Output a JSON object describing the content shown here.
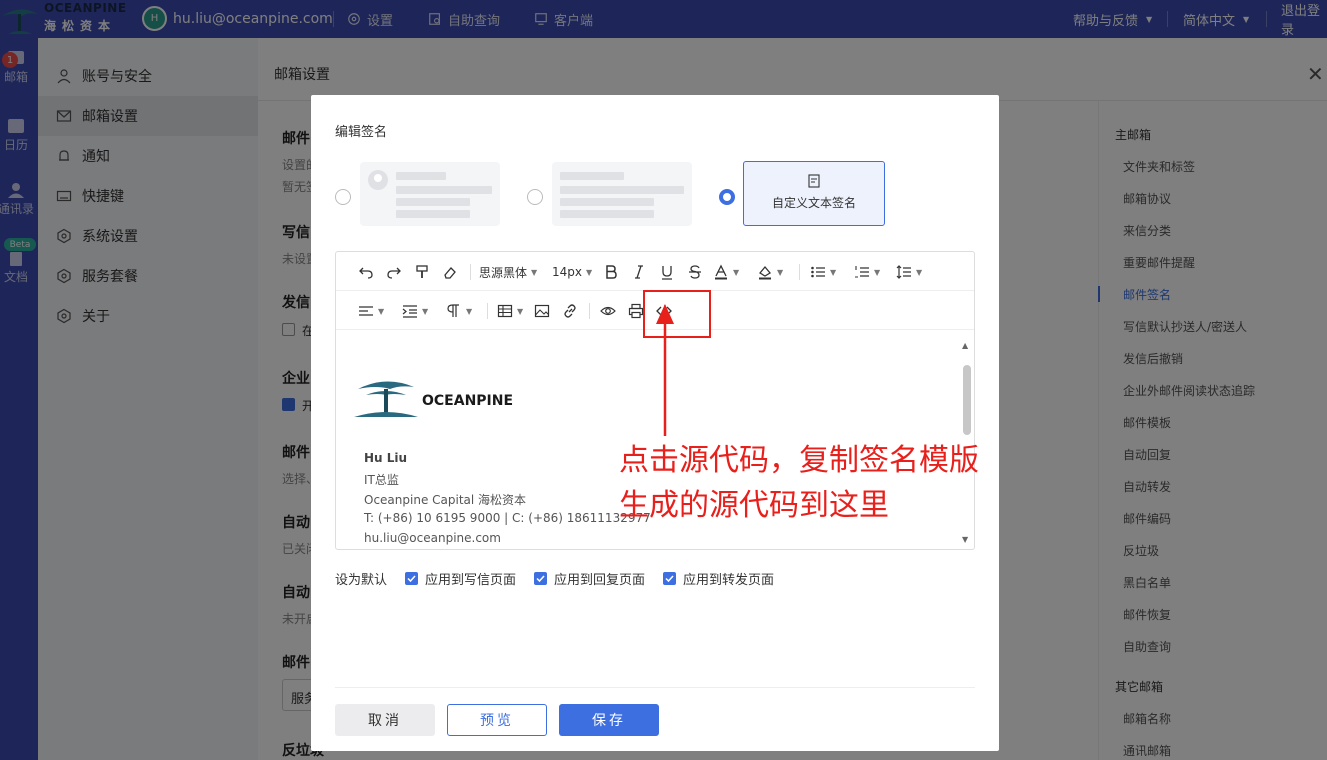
{
  "header": {
    "logo_en": "OCEANPINE",
    "logo_cn": "海松资本",
    "avatar_letter": "H",
    "account": "hu.liu@oceanpine.com",
    "nav": [
      {
        "label": "设置",
        "icon": "gear-icon"
      },
      {
        "label": "自助查询",
        "icon": "query-icon"
      },
      {
        "label": "客户端",
        "icon": "monitor-icon"
      }
    ],
    "help": "帮助与反馈",
    "language": "简体中文",
    "logout": "退出登录"
  },
  "rail": {
    "mail_badge": "1",
    "mail": "邮箱",
    "calendar": "日历",
    "contacts": "通讯录",
    "beta": "Beta",
    "docs": "文档"
  },
  "sidebar": {
    "items": [
      {
        "label": "账号与安全",
        "icon": "user-icon"
      },
      {
        "label": "邮箱设置",
        "icon": "mail-icon"
      },
      {
        "label": "通知",
        "icon": "bell-icon"
      },
      {
        "label": "快捷键",
        "icon": "keyboard-icon"
      },
      {
        "label": "系统设置",
        "icon": "hexagon-gear-icon"
      },
      {
        "label": "服务套餐",
        "icon": "hexagon-gear-icon"
      },
      {
        "label": "关于",
        "icon": "hexagon-gear-icon"
      }
    ]
  },
  "main": {
    "title": "邮箱设置",
    "sections": [
      {
        "title": "邮件",
        "sub": "设置的",
        "sub2": "暂无签"
      },
      {
        "title": "写信",
        "sub": "未设置"
      },
      {
        "title": "发信",
        "sub": "在"
      },
      {
        "title": "企业",
        "sub": "开"
      },
      {
        "title": "邮件",
        "sub": "选择、"
      },
      {
        "title": "自动",
        "sub": "已关闭"
      },
      {
        "title": "自动",
        "sub": "未开启"
      },
      {
        "title": "邮件",
        "sub": "服务"
      },
      {
        "title": "反垃圾"
      }
    ],
    "toc": {
      "group1": "主邮箱",
      "items": [
        "文件夹和标签",
        "邮箱协议",
        "来信分类",
        "重要邮件提醒",
        "邮件签名",
        "写信默认抄送人/密送人",
        "发信后撤销",
        "企业外邮件阅读状态追踪",
        "邮件模板",
        "自动回复",
        "自动转发",
        "邮件编码",
        "反垃圾",
        "黑白名单",
        "邮件恢复",
        "自助查询"
      ],
      "group2": "其它邮箱",
      "items2": [
        "邮箱名称",
        "通讯邮箱"
      ]
    }
  },
  "modal": {
    "title": "编辑签名",
    "custom_template": "自定义文本签名",
    "toolbar": {
      "font": "思源黑体",
      "size": "14px"
    },
    "signature": {
      "brand": "OCEANPINE",
      "name": "Hu Liu",
      "role": "IT总监",
      "company": "Oceanpine Capital 海松资本",
      "phone": "T: (+86) 10 6195 9000 | C: (+86) 18611132977",
      "email": "hu.liu@oceanpine.com"
    },
    "defaults_label": "设为默认",
    "defaults": [
      "应用到写信页面",
      "应用到回复页面",
      "应用到转发页面"
    ],
    "buttons": {
      "cancel": "取消",
      "preview": "预览",
      "save": "保存"
    }
  },
  "annotation": {
    "line1": "点击源代码，复制签名模版",
    "line2": "生成的源代码到这里"
  },
  "colors": {
    "brand": "#3d4db2",
    "accent": "#3d6fe0",
    "annotation": "#e8201c"
  }
}
